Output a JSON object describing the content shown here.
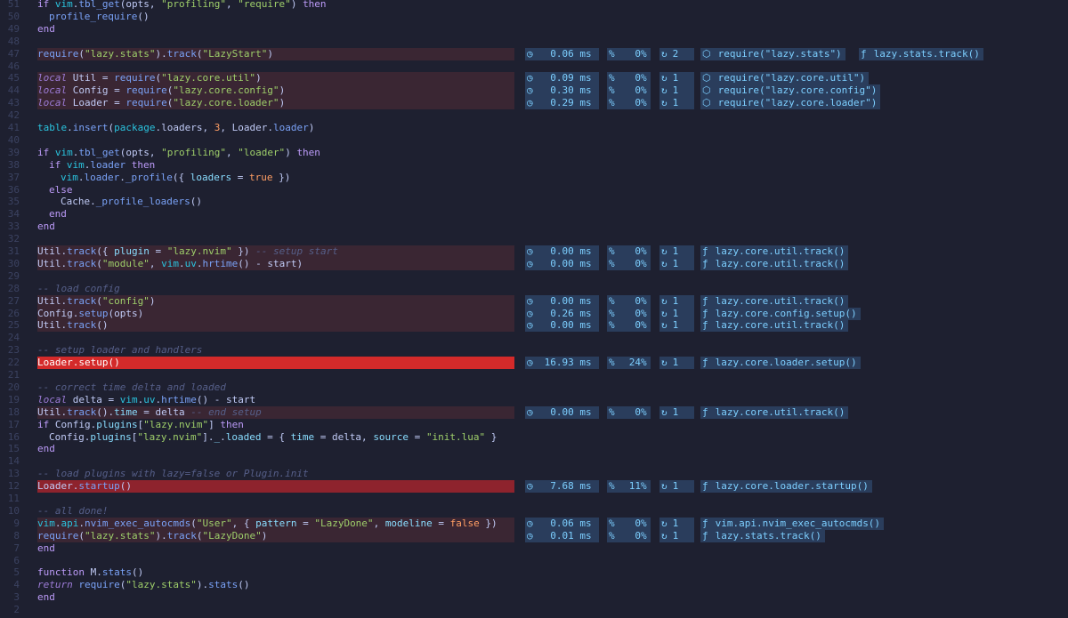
{
  "lines": [
    {
      "n": "51",
      "code": [
        {
          "t": "if ",
          "c": "k"
        },
        {
          "t": "vim",
          "c": "v"
        },
        {
          "t": ".",
          "c": "w"
        },
        {
          "t": "tbl_get",
          "c": "f"
        },
        {
          "t": "(opts, ",
          "c": "w"
        },
        {
          "t": "\"profiling\"",
          "c": "s"
        },
        {
          "t": ", ",
          "c": "w"
        },
        {
          "t": "\"require\"",
          "c": "s"
        },
        {
          "t": ") ",
          "c": "w"
        },
        {
          "t": "then",
          "c": "k"
        }
      ],
      "indent": 1
    },
    {
      "n": "50",
      "code": [
        {
          "t": "profile_require",
          "c": "f"
        },
        {
          "t": "()",
          "c": "w"
        }
      ],
      "indent": 2
    },
    {
      "n": "49",
      "code": [
        {
          "t": "end",
          "c": "k"
        }
      ],
      "indent": 1
    },
    {
      "n": "48",
      "code": [],
      "indent": 0
    },
    {
      "n": "47",
      "hl": "l1",
      "code": [
        {
          "t": "require",
          "c": "f"
        },
        {
          "t": "(",
          "c": "w"
        },
        {
          "t": "\"lazy.stats\"",
          "c": "s"
        },
        {
          "t": ").",
          "c": "w"
        },
        {
          "t": "track",
          "c": "f"
        },
        {
          "t": "(",
          "c": "w"
        },
        {
          "t": "\"LazyStart\"",
          "c": "s"
        },
        {
          "t": ")",
          "c": "w"
        }
      ],
      "indent": 1,
      "stats": {
        "time": "0.06 ms",
        "pct": "0%",
        "count": "2",
        "mod": "require(\"lazy.stats\")",
        "fn": "lazy.stats.track()"
      }
    },
    {
      "n": "46",
      "code": [],
      "indent": 0
    },
    {
      "n": "45",
      "hl": "l1",
      "code": [
        {
          "t": "local",
          "c": "i"
        },
        {
          "t": " Util = ",
          "c": "w"
        },
        {
          "t": "require",
          "c": "f"
        },
        {
          "t": "(",
          "c": "w"
        },
        {
          "t": "\"lazy.core.util\"",
          "c": "s"
        },
        {
          "t": ")",
          "c": "w"
        }
      ],
      "indent": 1,
      "stats": {
        "time": "0.09 ms",
        "pct": "0%",
        "count": "1",
        "mod": "require(\"lazy.core.util\")"
      }
    },
    {
      "n": "44",
      "hl": "l1",
      "code": [
        {
          "t": "local",
          "c": "i"
        },
        {
          "t": " Config = ",
          "c": "w"
        },
        {
          "t": "require",
          "c": "f"
        },
        {
          "t": "(",
          "c": "w"
        },
        {
          "t": "\"lazy.core.config\"",
          "c": "s"
        },
        {
          "t": ")",
          "c": "w"
        }
      ],
      "indent": 1,
      "stats": {
        "time": "0.30 ms",
        "pct": "0%",
        "count": "1",
        "mod": "require(\"lazy.core.config\")"
      }
    },
    {
      "n": "43",
      "hl": "l1",
      "code": [
        {
          "t": "local",
          "c": "i"
        },
        {
          "t": " Loader = ",
          "c": "w"
        },
        {
          "t": "require",
          "c": "f"
        },
        {
          "t": "(",
          "c": "w"
        },
        {
          "t": "\"lazy.core.loader\"",
          "c": "s"
        },
        {
          "t": ")",
          "c": "w"
        }
      ],
      "indent": 1,
      "stats": {
        "time": "0.29 ms",
        "pct": "0%",
        "count": "1",
        "mod": "require(\"lazy.core.loader\")"
      }
    },
    {
      "n": "42",
      "code": [],
      "indent": 0
    },
    {
      "n": "41",
      "code": [
        {
          "t": "table",
          "c": "v"
        },
        {
          "t": ".",
          "c": "w"
        },
        {
          "t": "insert",
          "c": "f"
        },
        {
          "t": "(",
          "c": "w"
        },
        {
          "t": "package",
          "c": "v"
        },
        {
          "t": ".loaders, ",
          "c": "w"
        },
        {
          "t": "3",
          "c": "n"
        },
        {
          "t": ", Loader.",
          "c": "w"
        },
        {
          "t": "loader",
          "c": "f"
        },
        {
          "t": ")",
          "c": "w"
        }
      ],
      "indent": 1
    },
    {
      "n": "40",
      "code": [],
      "indent": 0
    },
    {
      "n": "39",
      "code": [
        {
          "t": "if ",
          "c": "k"
        },
        {
          "t": "vim",
          "c": "v"
        },
        {
          "t": ".",
          "c": "w"
        },
        {
          "t": "tbl_get",
          "c": "f"
        },
        {
          "t": "(opts, ",
          "c": "w"
        },
        {
          "t": "\"profiling\"",
          "c": "s"
        },
        {
          "t": ", ",
          "c": "w"
        },
        {
          "t": "\"loader\"",
          "c": "s"
        },
        {
          "t": ") ",
          "c": "w"
        },
        {
          "t": "then",
          "c": "k"
        }
      ],
      "indent": 1
    },
    {
      "n": "38",
      "code": [
        {
          "t": "if ",
          "c": "k"
        },
        {
          "t": "vim",
          "c": "v"
        },
        {
          "t": ".",
          "c": "w"
        },
        {
          "t": "loader",
          "c": "f"
        },
        {
          "t": " then",
          "c": "k"
        }
      ],
      "indent": 2
    },
    {
      "n": "37",
      "code": [
        {
          "t": "vim",
          "c": "v"
        },
        {
          "t": ".",
          "c": "w"
        },
        {
          "t": "loader",
          "c": "f"
        },
        {
          "t": ".",
          "c": "w"
        },
        {
          "t": "_profile",
          "c": "f"
        },
        {
          "t": "({ ",
          "c": "w"
        },
        {
          "t": "loaders",
          "c": "p"
        },
        {
          "t": " = ",
          "c": "w"
        },
        {
          "t": "true",
          "c": "n"
        },
        {
          "t": " })",
          "c": "w"
        }
      ],
      "indent": 3
    },
    {
      "n": "36",
      "code": [
        {
          "t": "else",
          "c": "k"
        }
      ],
      "indent": 2
    },
    {
      "n": "35",
      "code": [
        {
          "t": "Cache.",
          "c": "w"
        },
        {
          "t": "_profile_loaders",
          "c": "f"
        },
        {
          "t": "()",
          "c": "w"
        }
      ],
      "indent": 3
    },
    {
      "n": "34",
      "code": [
        {
          "t": "end",
          "c": "k"
        }
      ],
      "indent": 2
    },
    {
      "n": "33",
      "code": [
        {
          "t": "end",
          "c": "k"
        }
      ],
      "indent": 1
    },
    {
      "n": "32",
      "code": [],
      "indent": 0
    },
    {
      "n": "31",
      "hl": "l1",
      "code": [
        {
          "t": "Util.",
          "c": "w"
        },
        {
          "t": "track",
          "c": "f"
        },
        {
          "t": "({ ",
          "c": "w"
        },
        {
          "t": "plugin",
          "c": "p"
        },
        {
          "t": " = ",
          "c": "w"
        },
        {
          "t": "\"lazy.nvim\"",
          "c": "s"
        },
        {
          "t": " }) ",
          "c": "w"
        },
        {
          "t": "-- setup start",
          "c": "c"
        }
      ],
      "indent": 1,
      "stats": {
        "time": "0.00 ms",
        "pct": "0%",
        "count": "1",
        "fn": "lazy.core.util.track()"
      }
    },
    {
      "n": "30",
      "hl": "l1",
      "code": [
        {
          "t": "Util.",
          "c": "w"
        },
        {
          "t": "track",
          "c": "f"
        },
        {
          "t": "(",
          "c": "w"
        },
        {
          "t": "\"module\"",
          "c": "s"
        },
        {
          "t": ", ",
          "c": "w"
        },
        {
          "t": "vim",
          "c": "v"
        },
        {
          "t": ".",
          "c": "w"
        },
        {
          "t": "uv",
          "c": "v"
        },
        {
          "t": ".",
          "c": "w"
        },
        {
          "t": "hrtime",
          "c": "f"
        },
        {
          "t": "() - start)",
          "c": "w"
        }
      ],
      "indent": 1,
      "stats": {
        "time": "0.00 ms",
        "pct": "0%",
        "count": "1",
        "fn": "lazy.core.util.track()"
      }
    },
    {
      "n": "29",
      "code": [],
      "indent": 0
    },
    {
      "n": "28",
      "code": [
        {
          "t": "-- load config",
          "c": "c"
        }
      ],
      "indent": 1
    },
    {
      "n": "27",
      "hl": "l1",
      "code": [
        {
          "t": "Util.",
          "c": "w"
        },
        {
          "t": "track",
          "c": "f"
        },
        {
          "t": "(",
          "c": "w"
        },
        {
          "t": "\"config\"",
          "c": "s"
        },
        {
          "t": ")",
          "c": "w"
        }
      ],
      "indent": 1,
      "stats": {
        "time": "0.00 ms",
        "pct": "0%",
        "count": "1",
        "fn": "lazy.core.util.track()"
      }
    },
    {
      "n": "26",
      "hl": "l1",
      "code": [
        {
          "t": "Config.",
          "c": "w"
        },
        {
          "t": "setup",
          "c": "f"
        },
        {
          "t": "(opts)",
          "c": "w"
        }
      ],
      "indent": 1,
      "stats": {
        "time": "0.26 ms",
        "pct": "0%",
        "count": "1",
        "fn": "lazy.core.config.setup()"
      }
    },
    {
      "n": "25",
      "hl": "l1",
      "code": [
        {
          "t": "Util.",
          "c": "w"
        },
        {
          "t": "track",
          "c": "f"
        },
        {
          "t": "()",
          "c": "w"
        }
      ],
      "indent": 1,
      "stats": {
        "time": "0.00 ms",
        "pct": "0%",
        "count": "1",
        "fn": "lazy.core.util.track()"
      }
    },
    {
      "n": "24",
      "code": [],
      "indent": 0
    },
    {
      "n": "23",
      "code": [
        {
          "t": "-- setup loader and handlers",
          "c": "c"
        }
      ],
      "indent": 1
    },
    {
      "n": "22",
      "hl": "l2",
      "code": [
        {
          "t": "Loader.",
          "c": "wt"
        },
        {
          "t": "setup",
          "c": "wt"
        },
        {
          "t": "()",
          "c": "wt"
        }
      ],
      "indent": 1,
      "stats": {
        "time": "16.93 ms",
        "pct": "24%",
        "count": "1",
        "fn": "lazy.core.loader.setup()"
      }
    },
    {
      "n": "21",
      "code": [],
      "indent": 0
    },
    {
      "n": "20",
      "code": [
        {
          "t": "-- correct time delta and loaded",
          "c": "c"
        }
      ],
      "indent": 1
    },
    {
      "n": "19",
      "code": [
        {
          "t": "local",
          "c": "i"
        },
        {
          "t": " delta = ",
          "c": "w"
        },
        {
          "t": "vim",
          "c": "v"
        },
        {
          "t": ".",
          "c": "w"
        },
        {
          "t": "uv",
          "c": "v"
        },
        {
          "t": ".",
          "c": "w"
        },
        {
          "t": "hrtime",
          "c": "f"
        },
        {
          "t": "() - start",
          "c": "w"
        }
      ],
      "indent": 1
    },
    {
      "n": "18",
      "hl": "l1",
      "code": [
        {
          "t": "Util.",
          "c": "w"
        },
        {
          "t": "track",
          "c": "f"
        },
        {
          "t": "().",
          "c": "w"
        },
        {
          "t": "time",
          "c": "p"
        },
        {
          "t": " = delta ",
          "c": "w"
        },
        {
          "t": "-- end setup",
          "c": "c"
        }
      ],
      "indent": 1,
      "stats": {
        "time": "0.00 ms",
        "pct": "0%",
        "count": "1",
        "fn": "lazy.core.util.track()"
      }
    },
    {
      "n": "17",
      "code": [
        {
          "t": "if ",
          "c": "k"
        },
        {
          "t": "Config.",
          "c": "w"
        },
        {
          "t": "plugins",
          "c": "p"
        },
        {
          "t": "[",
          "c": "w"
        },
        {
          "t": "\"lazy.nvim\"",
          "c": "s"
        },
        {
          "t": "] ",
          "c": "w"
        },
        {
          "t": "then",
          "c": "k"
        }
      ],
      "indent": 1
    },
    {
      "n": "16",
      "code": [
        {
          "t": "Config.",
          "c": "w"
        },
        {
          "t": "plugins",
          "c": "p"
        },
        {
          "t": "[",
          "c": "w"
        },
        {
          "t": "\"lazy.nvim\"",
          "c": "s"
        },
        {
          "t": "].",
          "c": "w"
        },
        {
          "t": "_",
          "c": "p"
        },
        {
          "t": ".",
          "c": "w"
        },
        {
          "t": "loaded",
          "c": "p"
        },
        {
          "t": " = { ",
          "c": "w"
        },
        {
          "t": "time",
          "c": "p"
        },
        {
          "t": " = delta, ",
          "c": "w"
        },
        {
          "t": "source",
          "c": "p"
        },
        {
          "t": " = ",
          "c": "w"
        },
        {
          "t": "\"init.lua\"",
          "c": "s"
        },
        {
          "t": " }",
          "c": "w"
        }
      ],
      "indent": 2
    },
    {
      "n": "15",
      "code": [
        {
          "t": "end",
          "c": "k"
        }
      ],
      "indent": 1
    },
    {
      "n": "14",
      "code": [],
      "indent": 0
    },
    {
      "n": "13",
      "code": [
        {
          "t": "-- load plugins with lazy=false or Plugin.init",
          "c": "c"
        }
      ],
      "indent": 1
    },
    {
      "n": "12",
      "hl": "l3",
      "code": [
        {
          "t": "Loader.",
          "c": "w"
        },
        {
          "t": "startup",
          "c": "f"
        },
        {
          "t": "()",
          "c": "w"
        }
      ],
      "indent": 1,
      "stats": {
        "time": "7.68 ms",
        "pct": "11%",
        "count": "1",
        "fn": "lazy.core.loader.startup()"
      }
    },
    {
      "n": "11",
      "code": [],
      "indent": 0
    },
    {
      "n": "10",
      "code": [
        {
          "t": "-- all done!",
          "c": "c"
        }
      ],
      "indent": 1
    },
    {
      "n": "9",
      "hl": "l1",
      "code": [
        {
          "t": "vim",
          "c": "v"
        },
        {
          "t": ".",
          "c": "w"
        },
        {
          "t": "api",
          "c": "v"
        },
        {
          "t": ".",
          "c": "w"
        },
        {
          "t": "nvim_exec_autocmds",
          "c": "f"
        },
        {
          "t": "(",
          "c": "w"
        },
        {
          "t": "\"User\"",
          "c": "s"
        },
        {
          "t": ", { ",
          "c": "w"
        },
        {
          "t": "pattern",
          "c": "p"
        },
        {
          "t": " = ",
          "c": "w"
        },
        {
          "t": "\"LazyDone\"",
          "c": "s"
        },
        {
          "t": ", ",
          "c": "w"
        },
        {
          "t": "modeline",
          "c": "p"
        },
        {
          "t": " = ",
          "c": "w"
        },
        {
          "t": "false",
          "c": "n"
        },
        {
          "t": " })",
          "c": "w"
        }
      ],
      "indent": 1,
      "stats": {
        "time": "0.06 ms",
        "pct": "0%",
        "count": "1",
        "fn": "vim.api.nvim_exec_autocmds()"
      }
    },
    {
      "n": "8",
      "hl": "l1",
      "code": [
        {
          "t": "require",
          "c": "f"
        },
        {
          "t": "(",
          "c": "w"
        },
        {
          "t": "\"lazy.stats\"",
          "c": "s"
        },
        {
          "t": ").",
          "c": "w"
        },
        {
          "t": "track",
          "c": "f"
        },
        {
          "t": "(",
          "c": "w"
        },
        {
          "t": "\"LazyDone\"",
          "c": "s"
        },
        {
          "t": ")",
          "c": "w"
        }
      ],
      "indent": 1,
      "stats": {
        "time": "0.01 ms",
        "pct": "0%",
        "count": "1",
        "fn": "lazy.stats.track()"
      }
    },
    {
      "n": "7",
      "code": [
        {
          "t": "end",
          "c": "k"
        }
      ],
      "indent": 0
    },
    {
      "n": "6",
      "code": [],
      "indent": 0
    },
    {
      "n": "5",
      "code": [
        {
          "t": "function ",
          "c": "k"
        },
        {
          "t": "M.",
          "c": "w"
        },
        {
          "t": "stats",
          "c": "f"
        },
        {
          "t": "()",
          "c": "w"
        }
      ],
      "indent": 0
    },
    {
      "n": "4",
      "code": [
        {
          "t": "return",
          "c": "i"
        },
        {
          "t": " ",
          "c": "w"
        },
        {
          "t": "require",
          "c": "f"
        },
        {
          "t": "(",
          "c": "w"
        },
        {
          "t": "\"lazy.stats\"",
          "c": "s"
        },
        {
          "t": ").",
          "c": "w"
        },
        {
          "t": "stats",
          "c": "f"
        },
        {
          "t": "()",
          "c": "w"
        }
      ],
      "indent": 1
    },
    {
      "n": "3",
      "code": [
        {
          "t": "end",
          "c": "k"
        }
      ],
      "indent": 0
    },
    {
      "n": "2",
      "code": [],
      "indent": 0
    }
  ],
  "icons": {
    "time": "clock-icon",
    "pct": "percent-icon",
    "count": "refresh-icon",
    "mod": "package-icon",
    "fn": "function-icon"
  },
  "colors": {
    "background": "#1e2030",
    "accent": "#7dcfff",
    "badge_bg": "#2a3d5c",
    "hot_line": "#d42a2a",
    "warm_line": "#8e232d",
    "tracked_line": "#3a2633"
  }
}
